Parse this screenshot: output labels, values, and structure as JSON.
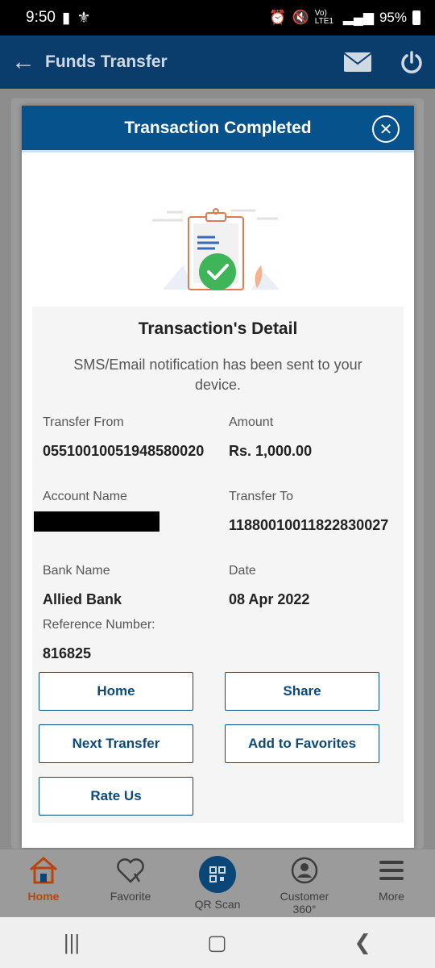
{
  "status_bar": {
    "time": "9:50",
    "battery": "95%",
    "network": "Vo) LTE1"
  },
  "header": {
    "title": "Funds Transfer"
  },
  "modal": {
    "title": "Transaction Completed",
    "detail_title": "Transaction's Detail",
    "notice": "SMS/Email notification has been sent to your device.",
    "fields": {
      "transfer_from_label": "Transfer From",
      "transfer_from_value": "05510010051948580020",
      "amount_label": "Amount",
      "amount_value": "Rs. 1,000.00",
      "account_name_label": "Account Name",
      "transfer_to_label": "Transfer To",
      "transfer_to_value": "11880010011822830027",
      "bank_name_label": "Bank Name",
      "bank_name_value": "Allied Bank",
      "date_label": "Date",
      "date_value": "08 Apr 2022",
      "reference_label": "Reference Number:",
      "reference_value": "816825"
    },
    "buttons": {
      "home": "Home",
      "share": "Share",
      "next_transfer": "Next Transfer",
      "add_favorites": "Add to Favorites",
      "rate_us": "Rate Us"
    }
  },
  "bottom_nav": [
    {
      "label": "Home",
      "icon": "home-icon",
      "active": true
    },
    {
      "label": "Favorite",
      "icon": "heart-icon",
      "active": false
    },
    {
      "label": "QR Scan",
      "icon": "qr-icon",
      "active": false
    },
    {
      "label": "Customer 360°",
      "icon": "customer-icon",
      "active": false
    },
    {
      "label": "More",
      "icon": "menu-icon",
      "active": false
    }
  ],
  "colors": {
    "primary": "#05528c",
    "header": "#0a3d6b",
    "accent": "#b8440f",
    "success": "#3fb55a"
  }
}
